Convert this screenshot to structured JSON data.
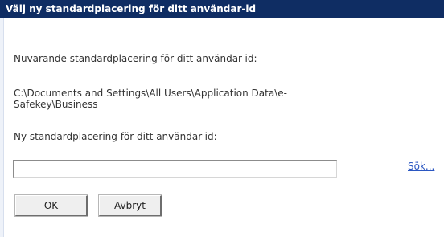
{
  "dialog": {
    "title": "Välj ny standardplacering för ditt användar-id",
    "current_label": "Nuvarande standardplacering för ditt användar-id:",
    "current_path": "C:\\Documents and Settings\\All Users\\Application Data\\e-\nSafekey\\Business",
    "new_label": "Ny standardplacering för ditt användar-id:",
    "new_path_value": "",
    "search_link": "Sök...",
    "ok_label": "OK",
    "cancel_label": "Avbryt"
  },
  "colors": {
    "titlebar": "#0f2d63",
    "link": "#2b57c2",
    "text": "#333333"
  }
}
